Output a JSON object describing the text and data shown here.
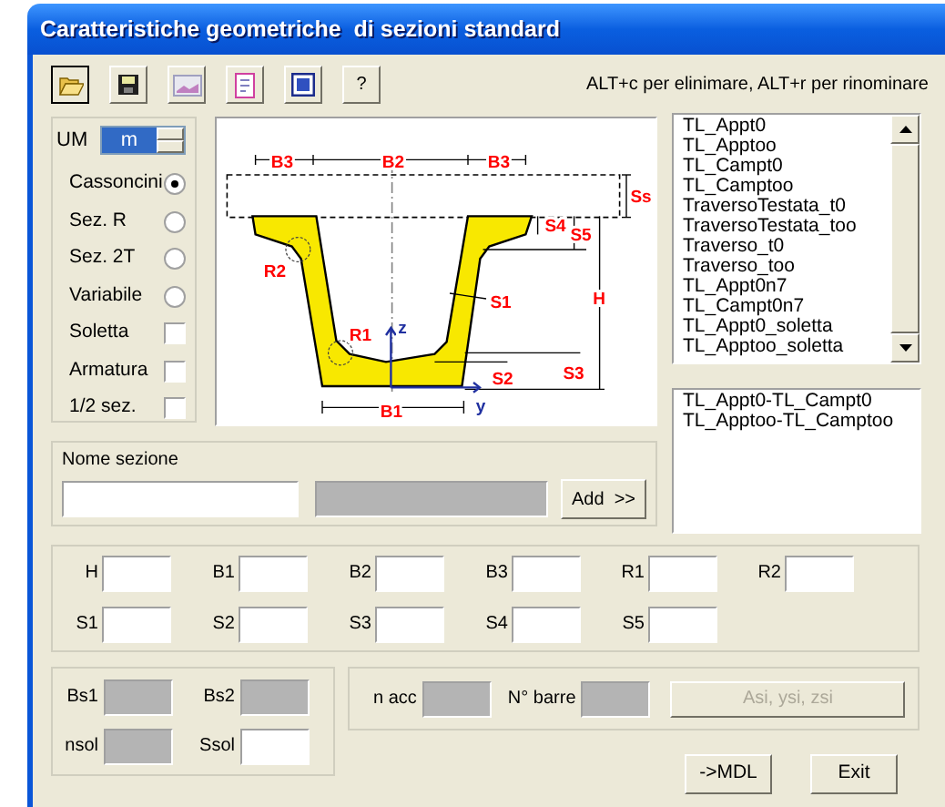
{
  "window": {
    "title": "Caratteristiche geometriche  di sezioni standard"
  },
  "toolbar": {
    "buttons": [
      {
        "kind": "folder",
        "pressed": true
      },
      {
        "kind": "floppy",
        "pressed": false
      },
      {
        "kind": "picture",
        "pressed": false
      },
      {
        "kind": "page",
        "pressed": false
      },
      {
        "kind": "word",
        "pressed": false
      },
      {
        "kind": "text",
        "label": "?",
        "pressed": false
      }
    ],
    "hint": "ALT+c per elinimare, ALT+r per rinominare"
  },
  "units": {
    "label": "UM",
    "value": "m"
  },
  "section_types": [
    {
      "label": "Cassoncini",
      "kind": "radio",
      "selected": true
    },
    {
      "label": "Sez. R",
      "kind": "radio",
      "selected": false
    },
    {
      "label": "Sez. 2T",
      "kind": "radio",
      "selected": false
    },
    {
      "label": "Variabile",
      "kind": "radio",
      "selected": false
    },
    {
      "label": "Soletta",
      "kind": "checkbox",
      "checked": false
    },
    {
      "label": "Armatura",
      "kind": "checkbox",
      "checked": false
    },
    {
      "label": "1/2 sez.",
      "kind": "checkbox",
      "checked": false
    }
  ],
  "diagram": {
    "labels": [
      "B3",
      "B2",
      "B3",
      "Ss",
      "S4",
      "S5",
      "R2",
      "S1",
      "H",
      "R1",
      "z",
      "S2",
      "S3",
      "B1",
      "y"
    ]
  },
  "sections_list": {
    "items": [
      {
        "label": "TL_Appt0",
        "selected": false
      },
      {
        "label": "TL_Apptoo",
        "selected": false
      },
      {
        "label": "TL_Campt0",
        "selected": false
      },
      {
        "label": "TL_Camptoo",
        "selected": false
      },
      {
        "label": "TraversoTestata_t0",
        "selected": false
      },
      {
        "label": "TraversoTestata_too",
        "selected": false
      },
      {
        "label": "Traverso_t0",
        "selected": false
      },
      {
        "label": "Traverso_too",
        "selected": false
      },
      {
        "label": "TL_Appt0n7",
        "selected": false
      },
      {
        "label": "TL_Campt0n7",
        "selected": false
      },
      {
        "label": "TL_Appt0_soletta",
        "selected": false
      },
      {
        "label": "TL_Apptoo_soletta",
        "selected": false
      }
    ]
  },
  "pairs_list": {
    "items": [
      {
        "label": "TL_Appt0-TL_Campt0",
        "selected": false
      },
      {
        "label": "TL_Apptoo-TL_Camptoo",
        "selected": false
      }
    ]
  },
  "name_section": {
    "label": "Nome sezione",
    "display_disabled": true,
    "add_button": "Add  >>"
  },
  "parameters": [
    {
      "label": "H"
    },
    {
      "label": "B1"
    },
    {
      "label": "B2"
    },
    {
      "label": "B3"
    },
    {
      "label": "R1"
    },
    {
      "label": "R2"
    },
    {
      "label": "S1"
    },
    {
      "label": "S2"
    },
    {
      "label": "S3"
    },
    {
      "label": "S4"
    },
    {
      "label": "S5"
    }
  ],
  "slab_fields": [
    {
      "label": "Bs1",
      "disabled": true
    },
    {
      "label": "Bs2",
      "disabled": true
    },
    {
      "label": "nsol",
      "disabled": true
    },
    {
      "label": "Ssol",
      "disabled": false
    }
  ],
  "rebar_fields": [
    {
      "label": "n acc",
      "disabled": true
    },
    {
      "label": "N° barre",
      "disabled": true
    }
  ],
  "rebar_button": {
    "label": "Asi, ysi, zsi",
    "disabled": true
  },
  "buttons": [
    {
      "label": "->MDL"
    },
    {
      "label": "Exit"
    }
  ]
}
